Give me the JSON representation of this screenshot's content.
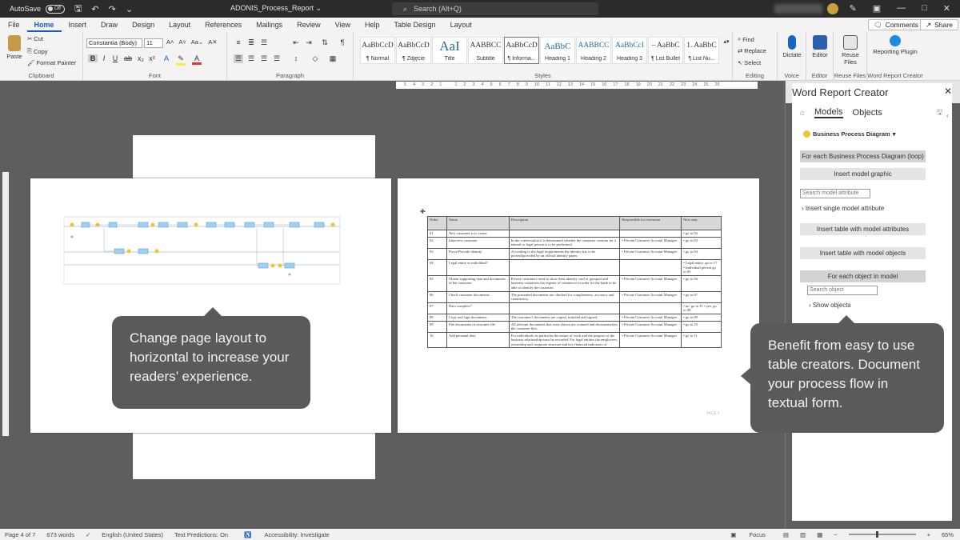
{
  "titlebar": {
    "autosave_label": "AutoSave",
    "autosave_state": "Off",
    "doc_title": "ADONIS_Process_Report",
    "search_placeholder": "Search (Alt+Q)"
  },
  "tabs": [
    "File",
    "Home",
    "Insert",
    "Draw",
    "Design",
    "Layout",
    "References",
    "Mailings",
    "Review",
    "View",
    "Help",
    "Table Design",
    "Layout"
  ],
  "active_tab": "Home",
  "comments_label": "Comments",
  "share_label": "Share",
  "ribbon": {
    "clipboard": {
      "paste": "Paste",
      "cut": "Cut",
      "copy": "Copy",
      "format_painter": "Format Painter",
      "label": "Clipboard"
    },
    "font": {
      "font_name": "Constantia (Body)",
      "font_size": "11",
      "label": "Font"
    },
    "paragraph_label": "Paragraph",
    "styles": {
      "label": "Styles",
      "items": [
        {
          "sample": "AaBbCcD",
          "name": "¶ Normal"
        },
        {
          "sample": "AaBbCcD",
          "name": "¶ Zdjęcie"
        },
        {
          "sample": "AaI",
          "name": "Title"
        },
        {
          "sample": "AABBCC",
          "name": "Subtitle"
        },
        {
          "sample": "AaBbCcD",
          "name": "¶ Informa..."
        },
        {
          "sample": "AaBbC",
          "name": "Heading 1"
        },
        {
          "sample": "AABBCC",
          "name": "Heading 2"
        },
        {
          "sample": "AaBbCcI",
          "name": "Heading 3"
        },
        {
          "sample": "– AaBbC",
          "name": "¶ List Bullet"
        },
        {
          "sample": "1. AaBbC",
          "name": "¶ List Nu..."
        }
      ]
    },
    "editing": {
      "find": "Find",
      "replace": "Replace",
      "select": "Select",
      "label": "Editing"
    },
    "voice": {
      "dictate": "Dictate",
      "label": "Voice"
    },
    "editor": {
      "editor": "Editor",
      "label": "Editor"
    },
    "reuse": {
      "button": "Reuse Files",
      "label": "Reuse Files"
    },
    "wrc": {
      "button": "Reporting Plugin",
      "label": "Word Report Creator"
    }
  },
  "ruler_marks": [
    "5",
    "4",
    "3",
    "2",
    "1",
    "",
    "1",
    "2",
    "3",
    "4",
    "5",
    "6",
    "7",
    "8",
    "9",
    "10",
    "11",
    "12",
    "13",
    "14",
    "15",
    "16",
    "17",
    "18",
    "19",
    "20",
    "21",
    "22",
    "23",
    "24",
    "25",
    "26"
  ],
  "callouts": {
    "left": "Change page layout to horizontal to increase your readers’ experience.",
    "right": "Benefit from easy to use table creators. Document your process flow in textual form."
  },
  "doc_table": {
    "headers": [
      "Order",
      "Name",
      "Description",
      "Responsible for execution",
      "Next step"
    ],
    "rows": [
      [
        "01",
        "New customer is to create",
        "",
        "",
        "• go to 02"
      ],
      [
        "02",
        "Interview customer",
        "In the conversation it is determined whether the customer creation for a natural or legal person is to be performed.",
        "• Private Customer Account Manager",
        "• go to 03"
      ],
      [
        "03",
        "Prove/Provide identity",
        "According to the legal requirements the identity has to be proved/provided by an official identity paper.",
        "• Private Customer Account Manager",
        "• go to 04"
      ],
      [
        "04",
        "Legal entity or individual?",
        "",
        "",
        "• Legal entity: go to 17 • Individual person go to 05"
      ],
      [
        "05",
        "Obtain supporting data and documents of the customer",
        "Private customers need to show their identity card or passport and business customers the register of commerce in order for the bank to be able to identify the customer.",
        "• Private Customer Account Manager",
        "• go to 06"
      ],
      [
        "06",
        "Check customer documents",
        "The presented documents are checked for completeness, accuracy and consistency.",
        "• Private Customer Account Manager",
        "• go to 07"
      ],
      [
        "07",
        "Data complete?",
        "",
        "",
        "• no: go to 11 • yes: go to 08"
      ],
      [
        "08",
        "Copy and sign documents",
        "The customer's documents are copied, initialed and signed.",
        "• Private Customer Account Manager",
        "• go to 09"
      ],
      [
        "09",
        "File documents in customer file",
        "All relevant documents that were shown are scanned and documented in the customer files.",
        "• Private Customer Account Manager",
        "• go to 10"
      ],
      [
        "10",
        "Add personal data",
        "For individuals, in particular the nature of work and the purpose of the business relationship must be recorded. For legal entities the employees, ownership and corporate structure and key financial indicators of",
        "• Private Customer Account Manager",
        "• go to 11"
      ]
    ],
    "page_footer": "PAGE 2"
  },
  "pane": {
    "title": "Word Report Creator",
    "tabs": [
      "Models",
      "Objects"
    ],
    "model_type": "Business Process Diagram",
    "for_each_diagram": "For each Business Process Diagram (loop)",
    "insert_model_graphic": "Insert model graphic",
    "search_attr_placeholder": "Search model attribute",
    "insert_single_attr": "Insert single model attribute",
    "insert_table_attrs": "Insert table with model attributes",
    "insert_table_objects": "Insert table with model objects",
    "for_each_object": "For each object in model",
    "search_object_placeholder": "Search object",
    "show_objects": "Show objects"
  },
  "status": {
    "page": "Page 4 of 7",
    "words": "673 words",
    "language": "English (United States)",
    "predictions": "Text Predictions: On",
    "accessibility": "Accessibility: Investigate",
    "focus": "Focus",
    "zoom": "65%"
  }
}
